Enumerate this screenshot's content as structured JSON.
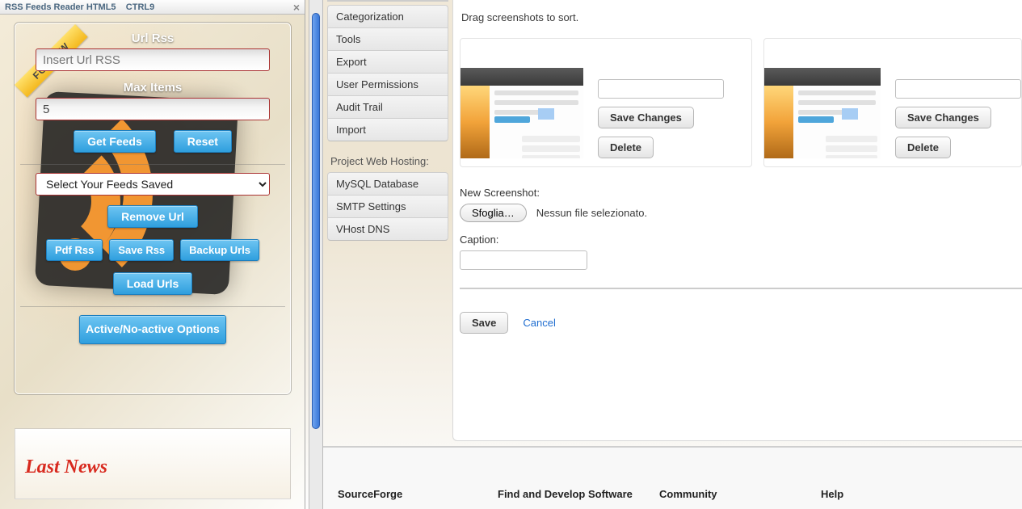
{
  "titlebar": {
    "title": "RSS Feeds Reader HTML5",
    "shortcut": "CTRL9"
  },
  "rss": {
    "url_label": "Url Rss",
    "url_placeholder": "Insert Url RSS",
    "max_items_label": "Max Items",
    "max_items_value": "5",
    "get_feeds": "Get Feeds",
    "reset": "Reset",
    "feeds_saved_option": "Select Your Feeds Saved",
    "remove_url": "Remove Url",
    "pdf_rss": "Pdf Rss",
    "save_rss": "Save Rss",
    "backup_urls": "Backup Urls",
    "load_urls": "Load Urls",
    "active_options": "Active/No-active Options",
    "follow_ribbon": "FOLLOW"
  },
  "last_news_heading": "Last News",
  "sidebar": {
    "group1": [
      "Categorization",
      "Tools",
      "Export",
      "User Permissions",
      "Audit Trail",
      "Import"
    ],
    "hosting_label": "Project Web Hosting:",
    "group2": [
      "MySQL Database",
      "SMTP Settings",
      "VHost DNS"
    ]
  },
  "main": {
    "drag_hint": "Drag screenshots to sort.",
    "save_changes": "Save Changes",
    "delete": "Delete",
    "new_screenshot_label": "New Screenshot:",
    "browse_btn": "Sfoglia…",
    "no_file": "Nessun file selezionato.",
    "caption_label": "Caption:",
    "save": "Save",
    "cancel": "Cancel"
  },
  "footer": {
    "c1": "SourceForge",
    "c2": "Find and Develop Software",
    "c3": "Community",
    "c4": "Help"
  }
}
